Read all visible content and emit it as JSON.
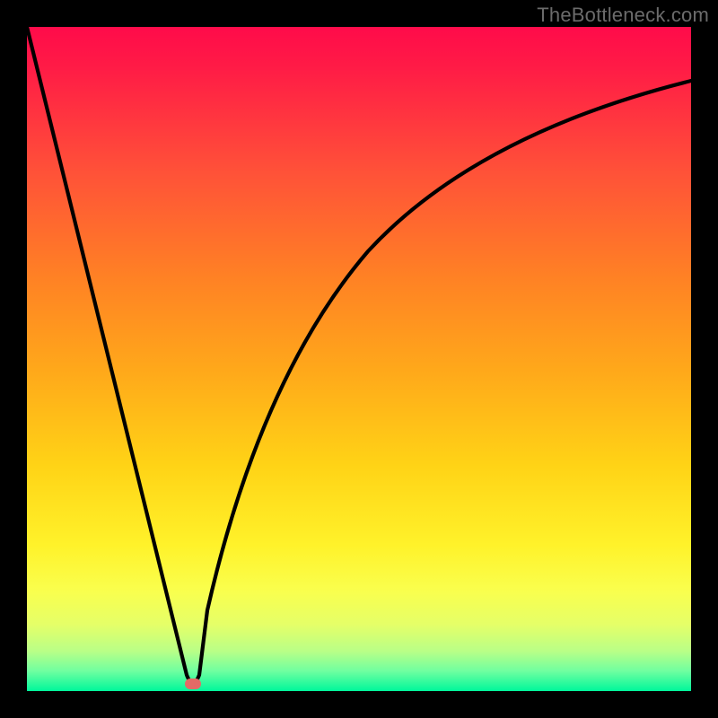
{
  "attribution": "TheBottleneck.com",
  "colors": {
    "frame": "#000000",
    "gradient_top": "#ff0b4a",
    "gradient_bottom": "#00f79b",
    "curve": "#000000",
    "marker": "#e46a66",
    "attribution_text": "#6b6b6b"
  },
  "chart_data": {
    "type": "line",
    "title": "",
    "xlabel": "",
    "ylabel": "",
    "xlim": [
      0,
      100
    ],
    "ylim": [
      0,
      100
    ],
    "x": [
      0,
      3,
      6,
      9,
      12,
      15,
      18,
      21,
      23,
      24.5,
      25,
      25.5,
      27,
      29,
      32,
      36,
      40,
      45,
      50,
      55,
      60,
      66,
      72,
      78,
      84,
      90,
      95,
      100
    ],
    "values": [
      100,
      89,
      78,
      66,
      55,
      44,
      33,
      22,
      11,
      3,
      0,
      3,
      12,
      22,
      35,
      48,
      57,
      65,
      71,
      76,
      80,
      83.5,
      86,
      88,
      89.5,
      90.8,
      91.6,
      92.3
    ],
    "marker": {
      "x": 25,
      "y": 0
    },
    "grid": false,
    "legend": false
  }
}
